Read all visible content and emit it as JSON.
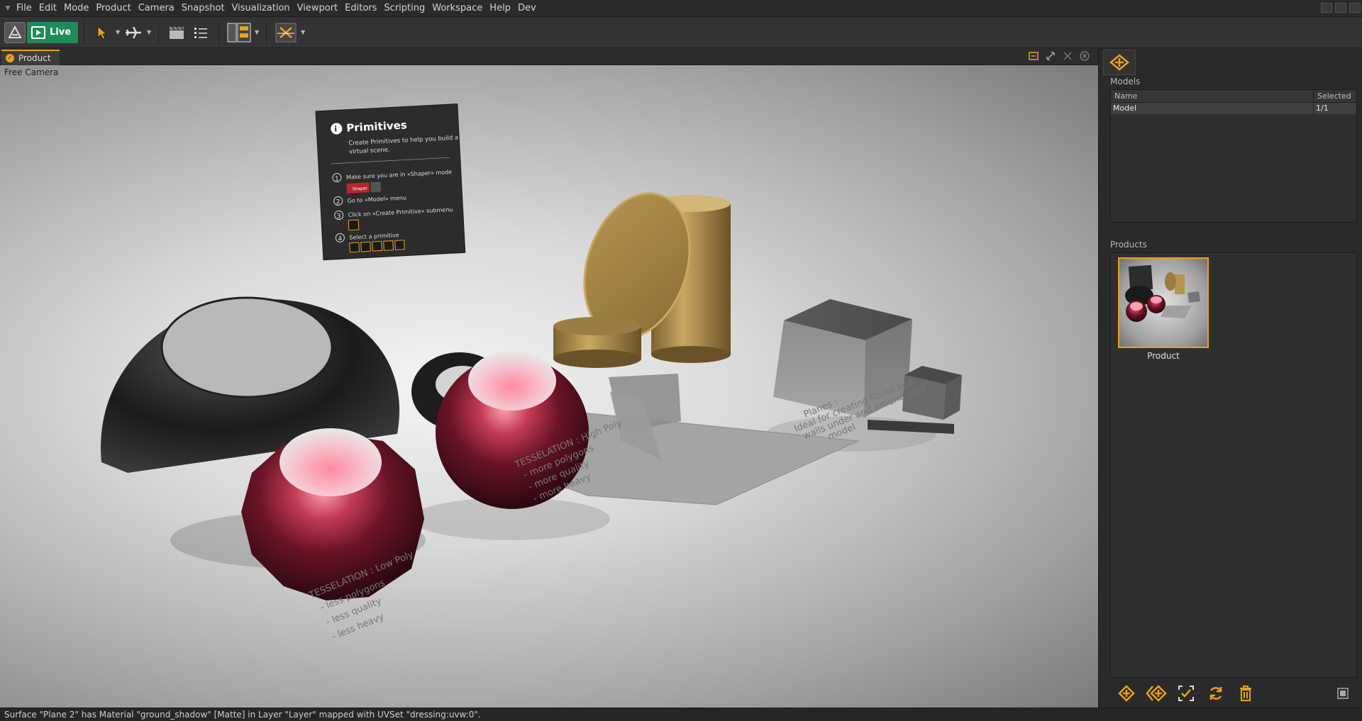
{
  "menu": {
    "items": [
      "File",
      "Edit",
      "Mode",
      "Product",
      "Camera",
      "Snapshot",
      "Visualization",
      "Viewport",
      "Editors",
      "Scripting",
      "Workspace",
      "Help",
      "Dev"
    ]
  },
  "toolbar": {
    "live_label": "Live"
  },
  "viewport": {
    "tab_label": "Product",
    "camera_label": "Free Camera"
  },
  "scene": {
    "info_card": {
      "title": "Primitives",
      "subtitle_line1": "Create Primitives to help you build a",
      "subtitle_line2": "virtual scene.",
      "step1": "Make sure you are in «Shaper» mode",
      "step1_badge": "Shaper",
      "step2": "Go to «Model» menu",
      "step3": "Click on «Create Primitive» submenu",
      "step4": "Select a primitive",
      "num1": "1",
      "num2": "2",
      "num3": "3",
      "num4": "4",
      "info_glyph": "i"
    },
    "floor_text_low": {
      "line1": "TESSELATION : Low Poly",
      "line2": "- less polygons",
      "line3": "- less quality",
      "line4": "- less heavy"
    },
    "floor_text_high": {
      "line1": "TESSELATION : High Poly",
      "line2": "- more polygons",
      "line3": "- more quality",
      "line4": "- more heavy"
    },
    "floor_text_planes": {
      "line1": "Planes :",
      "line2": "Ideal for creating floors and",
      "line3": "walls under and around your",
      "line4": "model"
    }
  },
  "models": {
    "title": "Models",
    "col_name": "Name",
    "col_selected": "Selected",
    "rows": [
      {
        "name": "Model",
        "selected": "1/1"
      }
    ]
  },
  "products": {
    "title": "Products",
    "items": [
      {
        "label": "Product"
      }
    ]
  },
  "status": {
    "text": "Surface \"Plane 2\" has Material \"ground_shadow\" [Matte] in Layer \"Layer\" mapped with UVSet \"dressing:uvw:0\"."
  },
  "colors": {
    "accent": "#e8a21a",
    "live_green": "#1e8c5a"
  }
}
